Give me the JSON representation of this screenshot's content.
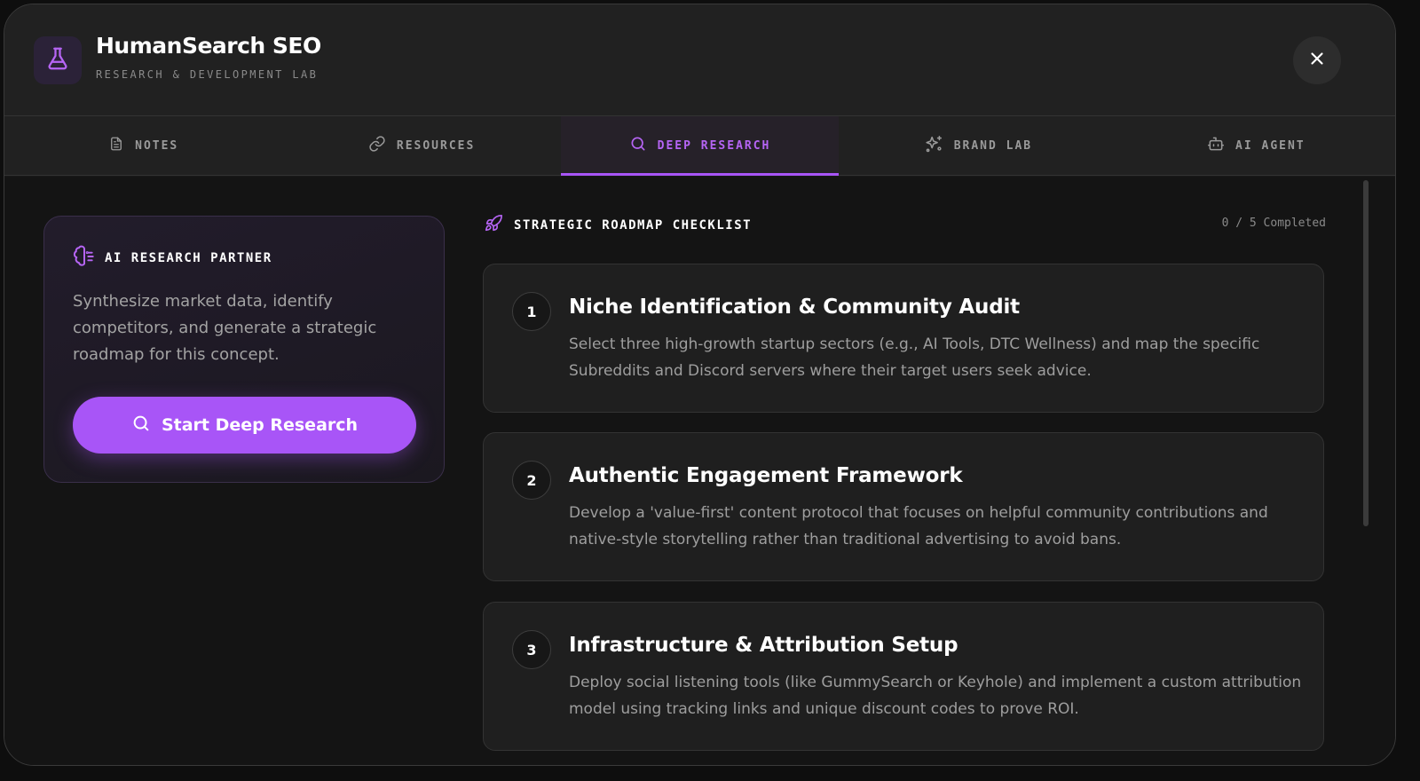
{
  "app": {
    "title": "HumanSearch SEO",
    "subtitle": "RESEARCH & DEVELOPMENT LAB",
    "logo_icon": "flask-icon",
    "close_icon": "close-icon"
  },
  "tabs": [
    {
      "label": "NOTES",
      "icon": "document-icon",
      "active": false
    },
    {
      "label": "RESOURCES",
      "icon": "link-icon",
      "active": false
    },
    {
      "label": "DEEP RESEARCH",
      "icon": "search-icon",
      "active": true
    },
    {
      "label": "BRAND LAB",
      "icon": "sparkles-icon",
      "active": false
    },
    {
      "label": "AI AGENT",
      "icon": "bot-icon",
      "active": false
    }
  ],
  "partner": {
    "title": "AI RESEARCH PARTNER",
    "icon": "brain-icon",
    "description": "Synthesize market data, identify competitors, and generate a strategic roadmap for this concept.",
    "button_label": "Start Deep Research",
    "button_icon": "search-icon"
  },
  "roadmap": {
    "title": "STRATEGIC ROADMAP CHECKLIST",
    "icon": "rocket-icon",
    "progress": "0 / 5 Completed",
    "steps": [
      {
        "number": "1",
        "title": "Niche Identification & Community Audit",
        "description": "Select three high-growth startup sectors (e.g., AI Tools, DTC Wellness) and map the specific Subreddits and Discord servers where their target users seek advice."
      },
      {
        "number": "2",
        "title": "Authentic Engagement Framework",
        "description": "Develop a 'value-first' content protocol that focuses on helpful community contributions and native-style storytelling rather than traditional advertising to avoid bans."
      },
      {
        "number": "3",
        "title": "Infrastructure & Attribution Setup",
        "description": "Deploy social listening tools (like GummySearch or Keyhole) and implement a custom attribution model using tracking links and unique discount codes to prove ROI."
      }
    ]
  },
  "colors": {
    "accent": "#a855f7",
    "accent_text": "#b665f5",
    "background": "#141414",
    "panel": "#1f1f1f"
  }
}
